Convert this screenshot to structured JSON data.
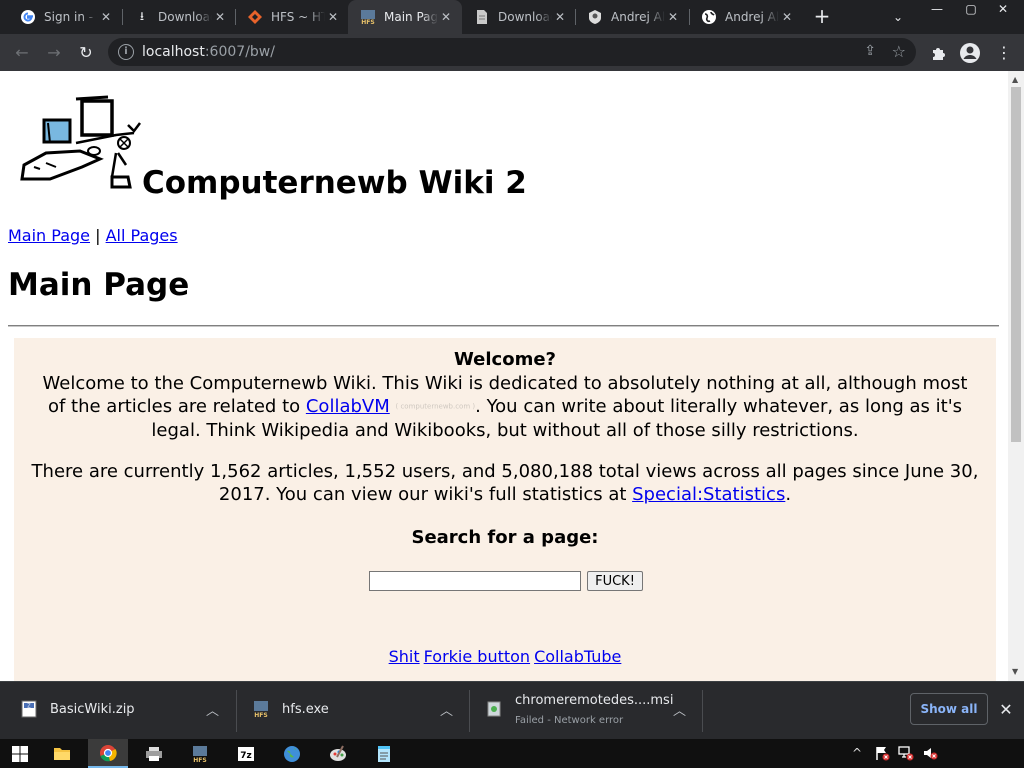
{
  "tabs": [
    {
      "title": "Sign in - Google Accounts",
      "icon": "google-icon"
    },
    {
      "title": "Downloads",
      "icon": "download-icon"
    },
    {
      "title": "HFS ~ HTTP File Server",
      "icon": "hfs-icon"
    },
    {
      "title": "Main Page",
      "icon": "hfs-icon",
      "active": true
    },
    {
      "title": "Downloads",
      "icon": "document-icon"
    },
    {
      "title": "Andrej Aleksandrov",
      "icon": "badge-icon"
    },
    {
      "title": "Andrej Aleksandrov",
      "icon": "globe-icon"
    }
  ],
  "address": {
    "host": "localhost",
    "path": ":6007/bw/"
  },
  "page": {
    "site_title": "Computernewb Wiki 2",
    "nav": {
      "main": "Main Page",
      "sep": "|",
      "all": "All Pages"
    },
    "heading": "Main Page",
    "welcome": {
      "title": "Welcome?",
      "p1_a": "Welcome to the Computernewb Wiki. This Wiki is dedicated to absolutely nothing at all, although most of the articles are related to ",
      "p1_link": "CollabVM",
      "p1_small": "( computernewb.com )",
      "p1_b": ". You can write about literally whatever, as long as it's legal. Think Wikipedia and Wikibooks, but without all of those silly restrictions.",
      "p2_a": "There are currently 1,562 articles, 1,552 users, and 5,080,188 total views across all pages since June 30, 2017. You can view our wiki's full statistics at ",
      "p2_link": "Special:Statistics",
      "p2_b": "."
    },
    "search": {
      "title": "Search for a page:",
      "value": "",
      "button": "FUCK!"
    },
    "links": [
      "Shit",
      "Forkie button",
      "CollabTube"
    ]
  },
  "downloads": [
    {
      "name": "BasicWiki.zip",
      "icon": "zip-icon"
    },
    {
      "name": "hfs.exe",
      "icon": "hfs-icon"
    },
    {
      "name": "chromeremotedes....msi",
      "status": "Failed - Network error",
      "icon": "installer-icon"
    }
  ],
  "download_bar": {
    "show_all": "Show all"
  },
  "taskbar": [
    "start-icon",
    "file-explorer-icon",
    "chrome-icon",
    "printer-icon",
    "hfs-icon",
    "7zip-icon",
    "globe-icon",
    "paint-icon",
    "notepad-icon"
  ]
}
